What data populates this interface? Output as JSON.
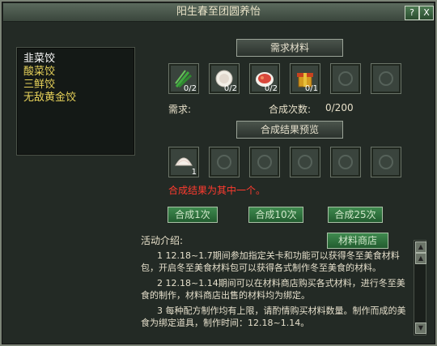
{
  "window": {
    "title": "阳生春至团圆养怡",
    "help_label": "?",
    "close_label": "X"
  },
  "recipes": [
    {
      "label": "韭菜饺",
      "color": "#ffffff"
    },
    {
      "label": "酸菜饺",
      "color": "#e7d25a"
    },
    {
      "label": "三鲜饺",
      "color": "#e7d25a"
    },
    {
      "label": "无敌黄金饺",
      "color": "#e7d25a"
    }
  ],
  "materials": {
    "header": "需求材料",
    "slots": [
      {
        "icon": "chive-icon",
        "count": "0/2"
      },
      {
        "icon": "dumpling-wrapper-icon",
        "count": "0/2"
      },
      {
        "icon": "meat-filling-icon",
        "count": "0/2"
      },
      {
        "icon": "golden-gift-icon",
        "count": "0/1"
      },
      {
        "icon": "empty-slot-icon",
        "count": ""
      },
      {
        "icon": "empty-slot-icon",
        "count": ""
      }
    ],
    "requirement_label": "需求:",
    "craft_times_label": "合成次数:",
    "craft_times_value": "0/200"
  },
  "result": {
    "header": "合成结果预览",
    "slots": [
      {
        "icon": "dumpling-icon",
        "count": "1"
      },
      {
        "icon": "empty-slot-icon",
        "count": ""
      },
      {
        "icon": "empty-slot-icon",
        "count": ""
      },
      {
        "icon": "empty-slot-icon",
        "count": ""
      },
      {
        "icon": "empty-slot-icon",
        "count": ""
      },
      {
        "icon": "empty-slot-icon",
        "count": ""
      }
    ],
    "note": "合成结果为其中一个。"
  },
  "buttons": {
    "craft_1": "合成1次",
    "craft_10": "合成10次",
    "craft_25": "合成25次",
    "material_shop": "材料商店"
  },
  "description": {
    "title": "活动介绍:",
    "paragraphs": [
      "1 12.18~1.7期间参加指定关卡和功能可以获得冬至美食材料包，开启冬至美食材料包可以获得各式制作冬至美食的材料。",
      "2 12.18~1.14期间可以在材料商店购买各式材料，进行冬至美食的制作，材料商店出售的材料均为绑定。",
      "3 每种配方制作均有上限，请酌情购买材料数量。制作而成的美食为绑定道具，制作时间：12.18~1.14。"
    ]
  },
  "colors": {
    "note_red": "#ff3b2f",
    "title_text": "#e9e3c8",
    "body_text": "#e5dfcb"
  }
}
